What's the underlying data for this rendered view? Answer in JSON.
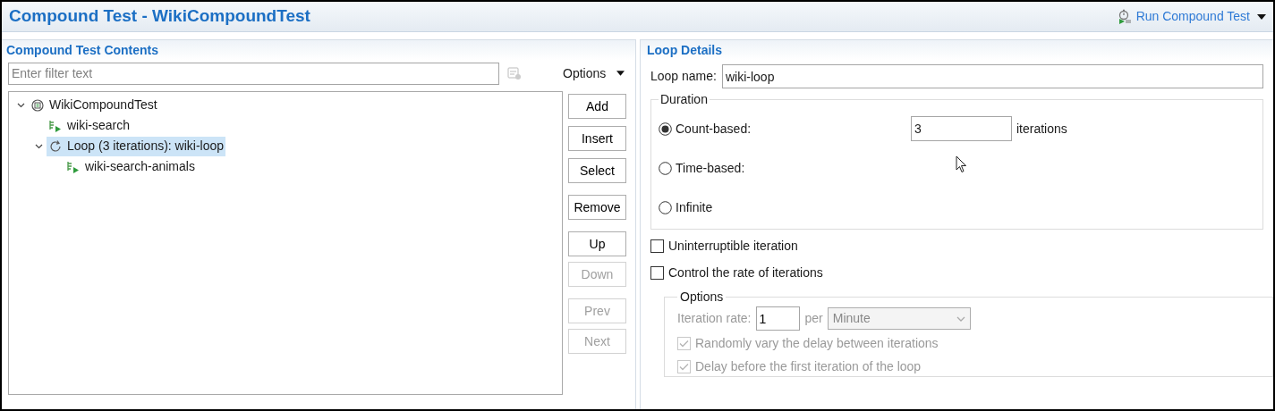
{
  "header": {
    "title": "Compound Test - WikiCompoundTest",
    "run_action": "Run Compound Test"
  },
  "contents": {
    "title": "Compound Test Contents",
    "filter": {
      "placeholder": "Enter filter text"
    },
    "options": "Options",
    "tree": [
      {
        "label": "WikiCompoundTest",
        "kind": "compound",
        "expanded": true,
        "selected": false,
        "children": [
          {
            "label": "wiki-search",
            "kind": "test",
            "selected": false
          },
          {
            "label": "Loop (3 iterations): wiki-loop",
            "kind": "loop",
            "expanded": true,
            "selected": true,
            "children": [
              {
                "label": "wiki-search-animals",
                "kind": "test",
                "selected": false
              }
            ]
          }
        ]
      }
    ],
    "buttons": [
      {
        "label": "Add",
        "disabled": false
      },
      {
        "label": "Insert",
        "disabled": false
      },
      {
        "label": "Select",
        "disabled": false
      },
      {
        "label": "Remove",
        "disabled": false
      },
      {
        "label": "Up",
        "disabled": false
      },
      {
        "label": "Down",
        "disabled": true
      },
      {
        "label": "Prev",
        "disabled": true
      },
      {
        "label": "Next",
        "disabled": true
      }
    ]
  },
  "details": {
    "title": "Loop Details",
    "loop_name": {
      "label": "Loop name:",
      "value": "wiki-loop"
    },
    "duration": {
      "title": "Duration",
      "options": [
        {
          "label": "Count-based:",
          "selected": true,
          "value": "3",
          "unit": "iterations"
        },
        {
          "label": "Time-based:",
          "selected": false
        },
        {
          "label": "Infinite",
          "selected": false
        }
      ]
    },
    "checks": [
      {
        "label": "Uninterruptible iteration",
        "checked": false
      },
      {
        "label": "Control the rate of iterations",
        "checked": false
      }
    ],
    "rate_options": {
      "title": "Options",
      "disabled": true,
      "rate_label": "Iteration rate:",
      "rate": "1",
      "per": "per",
      "unit": "Minute",
      "checks": [
        {
          "label": "Randomly vary the delay between iterations",
          "checked": true
        },
        {
          "label": "Delay before the first iteration of the loop",
          "checked": true
        }
      ]
    }
  }
}
